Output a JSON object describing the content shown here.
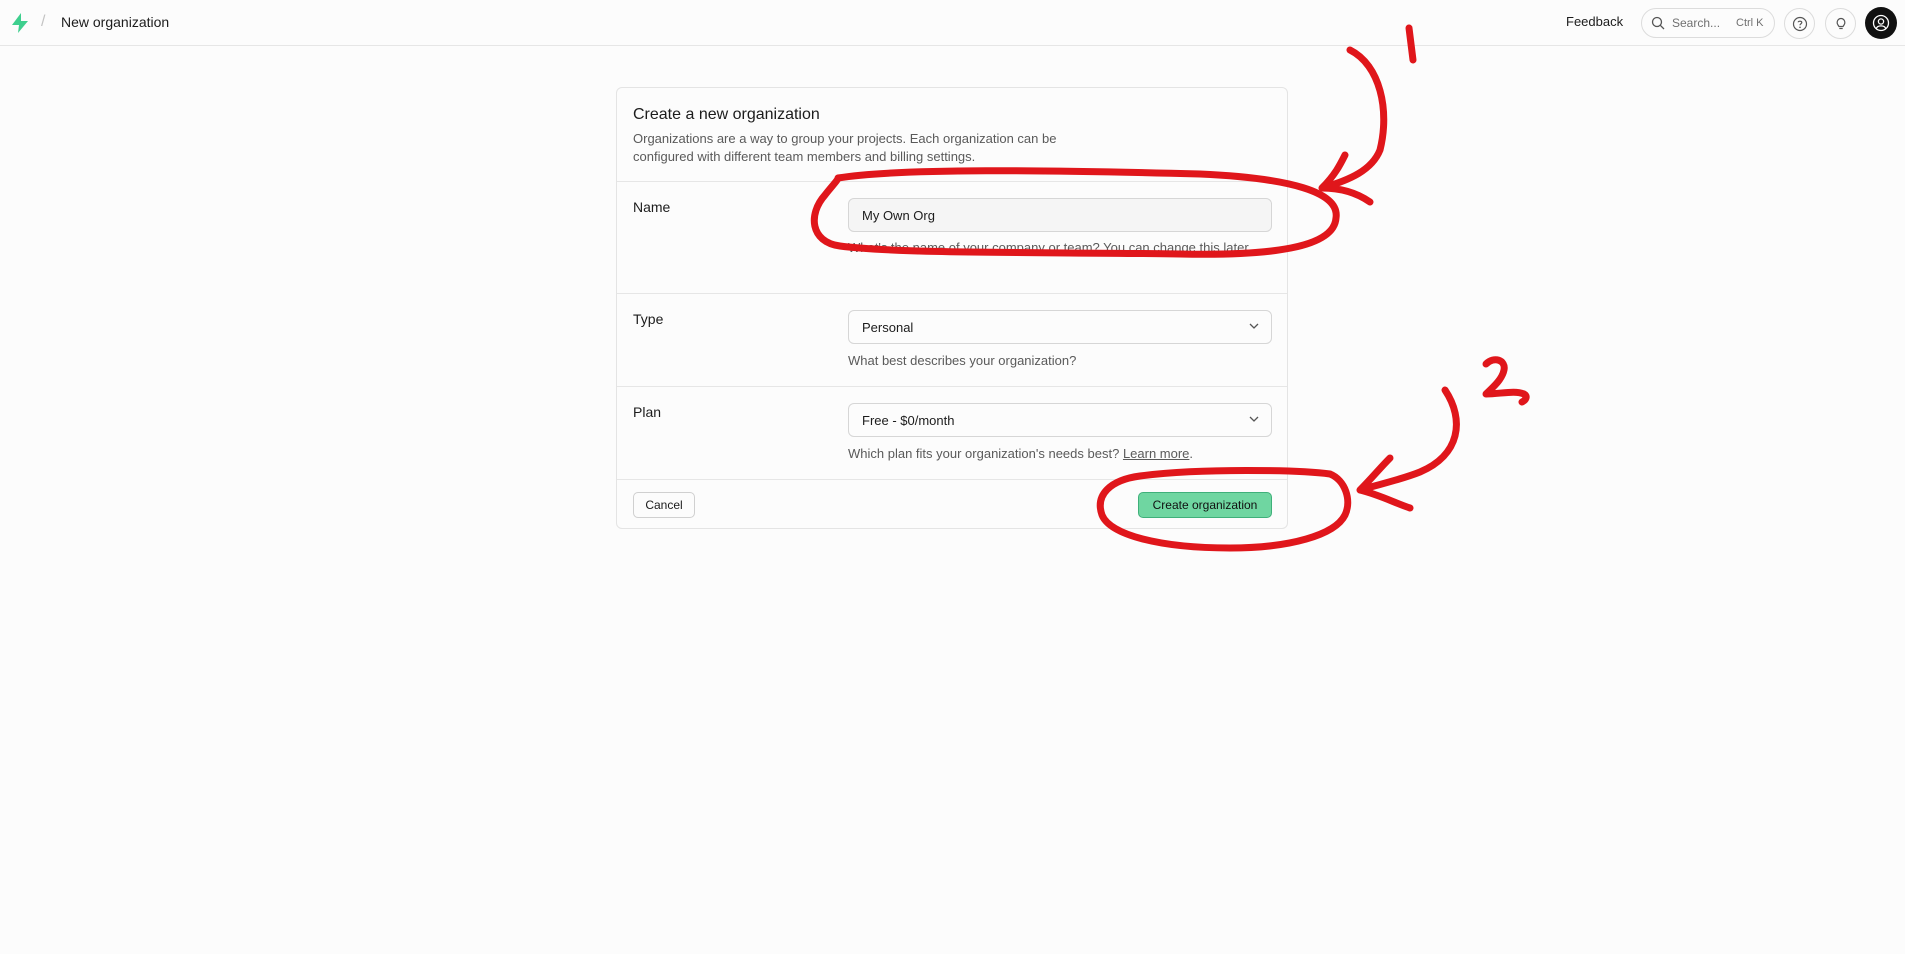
{
  "header": {
    "breadcrumb_separator": "/",
    "page_title": "New organization",
    "feedback_label": "Feedback",
    "search_placeholder": "Search...",
    "search_shortcut": "Ctrl K"
  },
  "card": {
    "title": "Create a new organization",
    "description": "Organizations are a way to group your projects. Each organization can be configured with different team members and billing settings.",
    "name_label": "Name",
    "name_value": "My Own Org",
    "name_help": "What's the name of your company or team? You can change this later.",
    "type_label": "Type",
    "type_value": "Personal",
    "type_help": "What best describes your organization?",
    "plan_label": "Plan",
    "plan_value": "Free - $0/month",
    "plan_help": "Which plan fits your organization's needs best?",
    "plan_help_link": "Learn more",
    "cancel_label": "Cancel",
    "create_label": "Create organization"
  },
  "annotations": {
    "step1": "1",
    "step2": "2",
    "color": "#e0161b"
  },
  "colors": {
    "brand": "#3ecf8e",
    "primary_button": "#6fd6a1"
  }
}
